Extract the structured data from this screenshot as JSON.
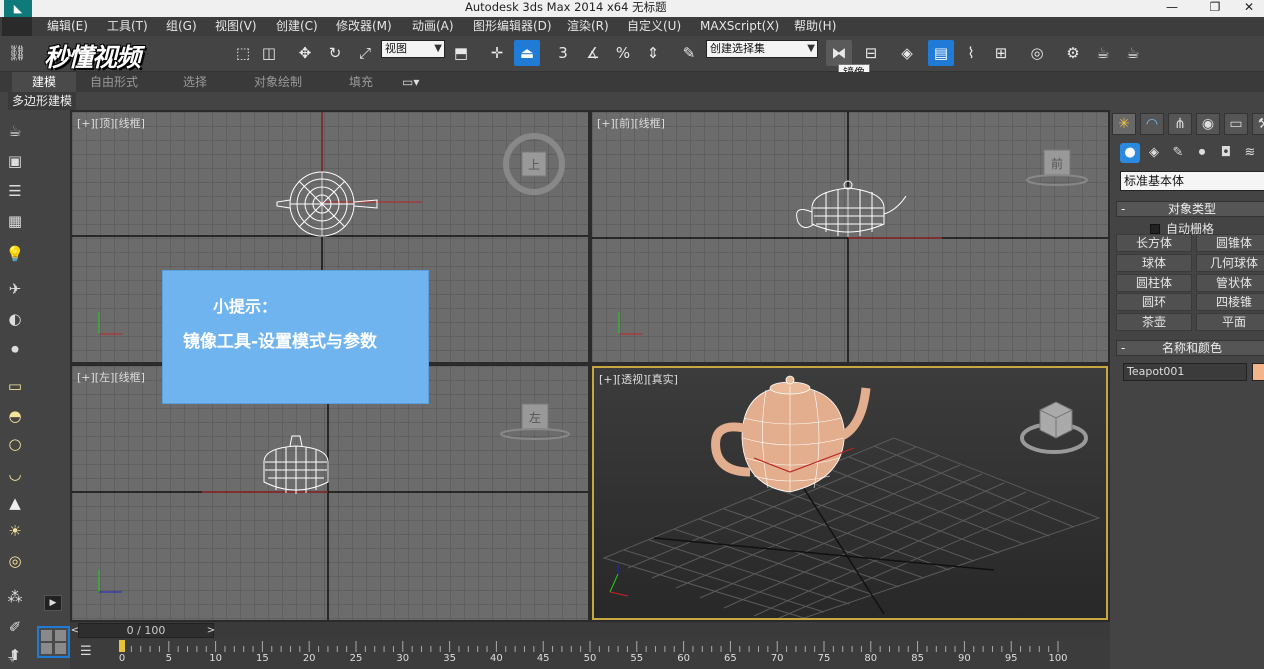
{
  "titlebar": {
    "title": "Autodesk 3ds Max  2014 x64     无标题",
    "app_icon": "3ds-max-logo-icon",
    "minimize": "—",
    "restore": "❐",
    "close": "✕"
  },
  "menu": {
    "items": [
      "编辑(E)",
      "工具(T)",
      "组(G)",
      "视图(V)",
      "创建(C)",
      "修改器(M)",
      "动画(A)",
      "图形编辑器(D)",
      "渲染(R)",
      "自定义(U)",
      "MAXScript(X)",
      "帮助(H)"
    ]
  },
  "toolbar": {
    "view_dropdown": "视图",
    "selection_set_dropdown": "创建选择集",
    "tooltip": "镜像",
    "icons": [
      "link-icon",
      "select-icon",
      "move-icon",
      "rotate-icon",
      "scale-icon",
      "snap-3-icon",
      "angle-snap-icon",
      "percent-snap-icon",
      "spinner-snap-icon",
      "edit-named-sel-icon",
      "mirror-icon",
      "align-icon",
      "layer-icon",
      "scene-explorer-icon",
      "curve-editor-icon",
      "schematic-icon",
      "material-editor-icon",
      "render-setup-icon",
      "render-frame-icon",
      "render-icon"
    ]
  },
  "logo": {
    "text": "秒懂视频"
  },
  "ribbon": {
    "tabs": [
      "建模",
      "自由形式",
      "选择",
      "对象绘制",
      "填充"
    ],
    "active_tab": "建模",
    "extra": "▾",
    "sub_label": "多边形建模"
  },
  "viewports": {
    "top": {
      "label": "[+][顶][线框]",
      "cube_face": "上"
    },
    "front": {
      "label": "[+][前][线框]",
      "cube_face": "前"
    },
    "left": {
      "label": "[+][左][线框]",
      "cube_face": "左"
    },
    "perspective": {
      "label": "[+][透视][真实]"
    }
  },
  "hint": {
    "title": "小提示：",
    "body": "镜像工具-设置模式与参数"
  },
  "command_panel": {
    "dropdown": "标准基本体",
    "object_type_header": "对象类型",
    "autogrid": "自动栅格",
    "buttons": [
      "长方体",
      "圆锥体",
      "球体",
      "几何球体",
      "圆柱体",
      "管状体",
      "圆环",
      "四棱锥",
      "茶壶",
      "平面"
    ],
    "name_color_header": "名称和颜色",
    "object_name": "Teapot001",
    "object_color": "#f3b48a"
  },
  "timeline": {
    "slider_text": "0 / 100",
    "left_arrow": "<",
    "right_arrow": ">",
    "ticks": [
      "0",
      "5",
      "10",
      "15",
      "20",
      "25",
      "30",
      "35",
      "40",
      "45",
      "50",
      "55",
      "60",
      "65",
      "70",
      "75",
      "80",
      "85",
      "90",
      "95",
      "100"
    ]
  },
  "colors": {
    "accent_blue": "#1f7bd6",
    "active_viewport_border": "#c9a740",
    "hint_bg": "#6fb3ef"
  }
}
